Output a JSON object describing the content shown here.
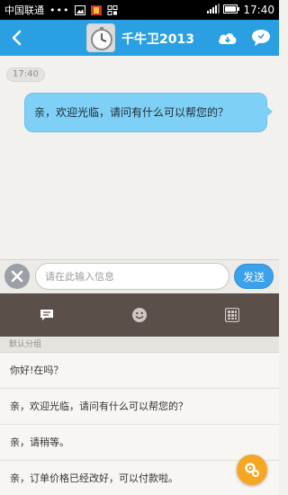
{
  "status_bar": {
    "carrier": "中国联通",
    "dots": "•••",
    "time": "17:40",
    "icons": [
      "image-icon",
      "app-icon",
      "sim-icon",
      "signal-icon",
      "battery-icon"
    ]
  },
  "header": {
    "title": "千牛卫2013",
    "back_icon": "back-arrow-icon",
    "left_action_icon": "cloud-download-icon",
    "right_action_icon": "chat-bubble-icon",
    "accent": "#2aa0e2"
  },
  "chat": {
    "timestamp": "17:40",
    "messages": [
      {
        "text": "亲，欢迎光临，请问有什么可以帮您的？",
        "from": "self",
        "color": "#7fd0f6"
      }
    ]
  },
  "input": {
    "placeholder": "请在此输入信息",
    "value": "",
    "send_label": "发送"
  },
  "toolbar": {
    "tabs": [
      {
        "icon": "quick-reply-icon",
        "active": true
      },
      {
        "icon": "emoji-icon",
        "active": false
      },
      {
        "icon": "grid-icon",
        "active": false
      }
    ]
  },
  "quick_replies": {
    "group_title": "默认分组",
    "items": [
      "你好!在吗？",
      "亲，欢迎光临，请问有什么可以帮您的？",
      "亲，请稍等。",
      "亲，订单价格已经改好，可以付款啦。"
    ]
  },
  "fab": {
    "icon": "settings-gear-icon"
  }
}
